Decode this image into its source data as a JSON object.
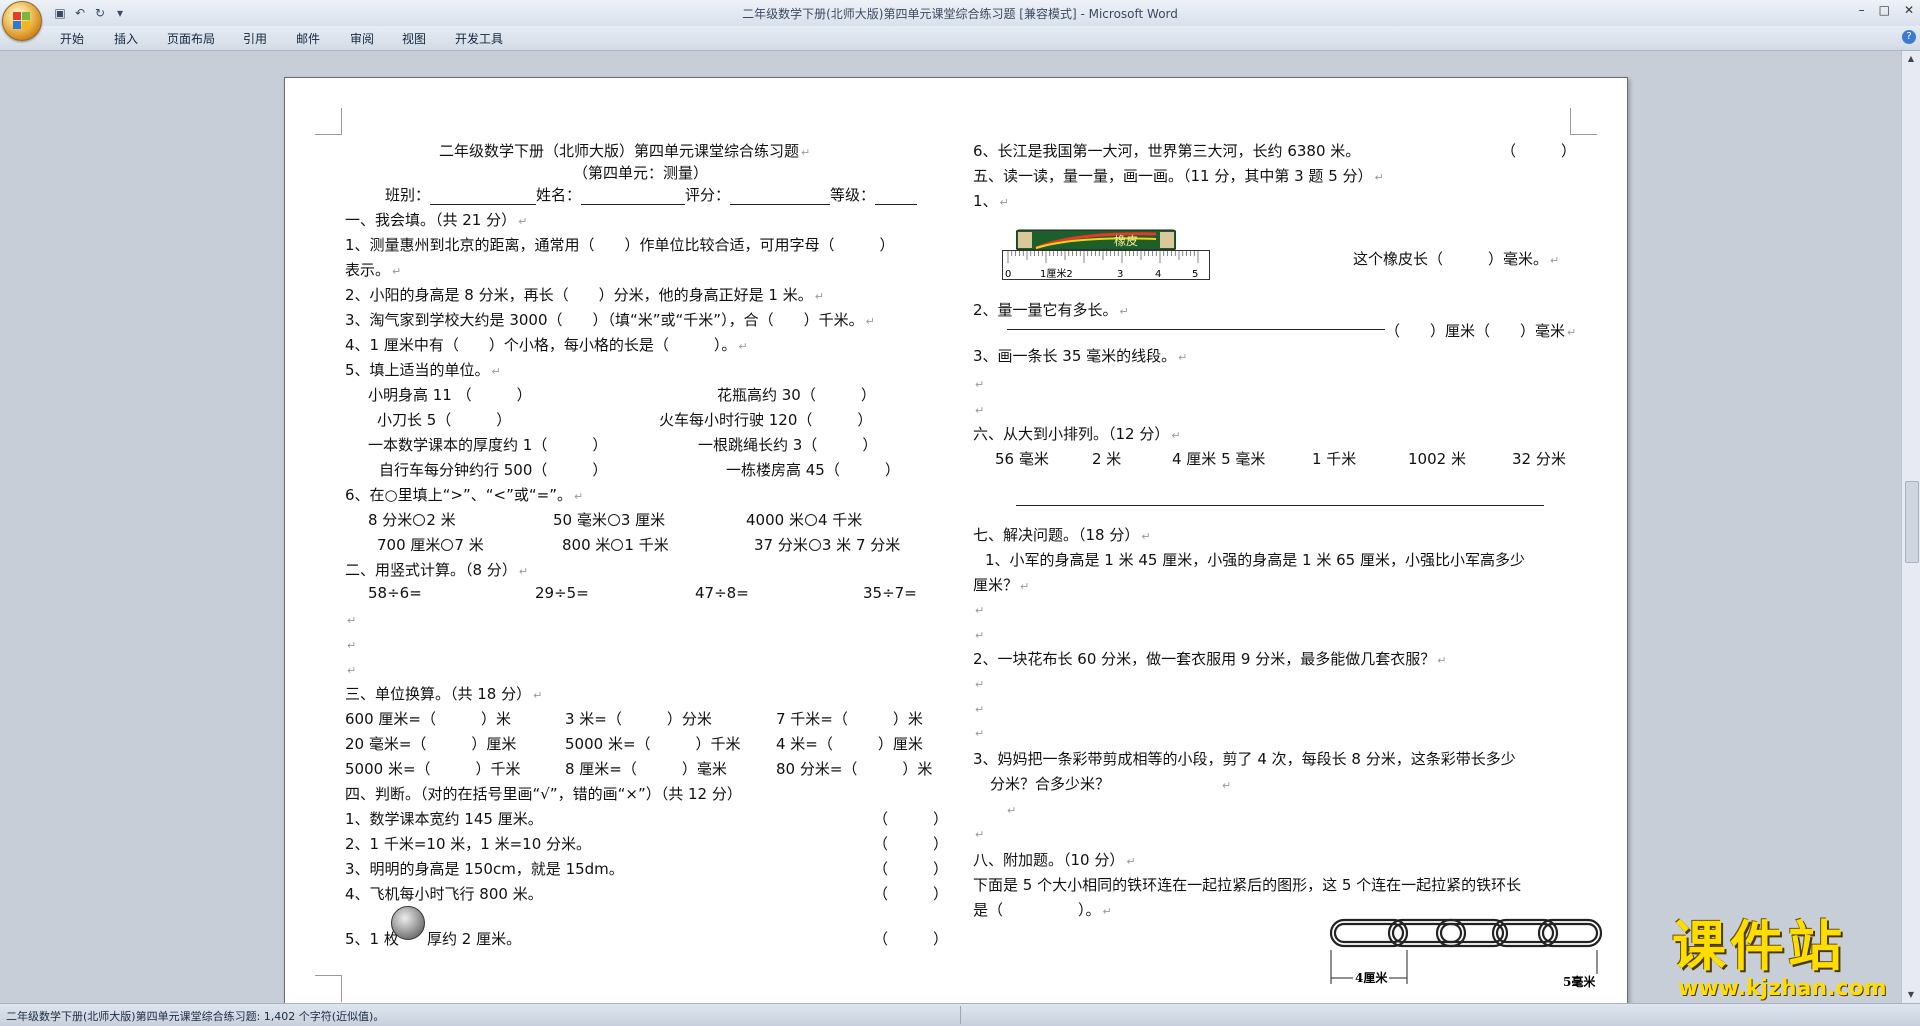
{
  "window": {
    "title": "二年级数学下册(北师大版)第四单元课堂综合练习题 [兼容模式] - Microsoft Word",
    "qat_icons": [
      "save-icon",
      "undo-icon",
      "redo-icon",
      "customize-icon"
    ]
  },
  "ribbon": {
    "tabs": [
      "开始",
      "插入",
      "页面布局",
      "引用",
      "邮件",
      "审阅",
      "视图",
      "开发工具"
    ],
    "help": "?"
  },
  "status": {
    "text": "二年级数学下册(北师大版)第四单元课堂综合练习题: 1,402 个字符(近似值)。"
  },
  "doc": {
    "title": "二年级数学下册（北师大版）第四单元课堂综合练习题",
    "subtitle": "（第四单元：测量）",
    "header": {
      "class": "班别：",
      "name": "姓名：",
      "score": "评分：",
      "grade": "等级："
    },
    "s1": {
      "heading": "一、我会填。（共 21 分）",
      "q1a": "1、测量惠州到北京的距离，通常用（　　）作单位比较合适，可用字母（　　　）",
      "q1b": "表示。",
      "q2": "2、小阳的身高是 8 分米，再长（　　）分米，他的身高正好是 1 米。",
      "q3": "3、淘气家到学校大约是 3000（　　）（填“米”或“千米”），合（　　）千米。",
      "q4": "4、1 厘米中有（　　）个小格，每小格的长是（　　　）。",
      "q5": "5、填上适当的单位。",
      "q5_items": [
        "小明身高 11 （　　　）",
        "花瓶高约 30（　　　）",
        "小刀长 5（　　　）",
        "火车每小时行驶 120（　　　）",
        "一本数学课本的厚度约 1（　　　）",
        "一根跳绳长约 3（　　　）",
        "自行车每分钟约行 500（　　　）",
        "一栋楼房高 45（　　　）"
      ],
      "q6": "6、在○里填上“>”、“<”或“=”。",
      "q6_items": [
        [
          "8 分米",
          "2 米"
        ],
        [
          "50 毫米",
          "3 厘米"
        ],
        [
          "4000 米",
          "4 千米"
        ],
        [
          "700 厘米",
          "7 米"
        ],
        [
          "800 米",
          "1 千米"
        ],
        [
          "37 分米",
          "3 米 7 分米"
        ]
      ]
    },
    "s2": {
      "heading": "二、用竖式计算。（8 分）",
      "items": [
        "58÷6=",
        "29÷5=",
        "47÷8=",
        "35÷7="
      ]
    },
    "s3": {
      "heading": "三、单位换算。（共 18 分）",
      "rows": [
        [
          "600 厘米=（　　　）米",
          "3 米=（　　　）分米",
          "7 千米=（　　　）米"
        ],
        [
          "20 毫米=（　　　）厘米",
          "5000 米=（　　　）千米",
          "4 米=（　　　）厘米"
        ],
        [
          "5000 米=（　　　）千米",
          "8 厘米=（　　　）毫米",
          "80 分米=（　　　）米"
        ]
      ]
    },
    "s4": {
      "heading": "四、判断。（对的在括号里画“√”，错的画“×”）（共 12 分）",
      "items": [
        "1、数学课本宽约 145 厘米。",
        "2、1 千米=10 米，1 米=10 分米。",
        "3、明明的身高是 150cm，就是 15dm。",
        "4、飞机每小时飞行 800 米。"
      ],
      "q5a": "5、1 枚",
      "q5b": "厚约 2 厘米。",
      "paren": "（　　　）"
    },
    "right": {
      "q6": "6、长江是我国第一大河，世界第三大河，长约 6380 米。",
      "q6_paren": "（　　　）",
      "s5_heading": "五、读一读，量一量，画一画。（11 分，其中第 3 题 5 分）",
      "s5_q1": "1、",
      "eraser_label": "橡皮",
      "ruler_ticks": [
        "0",
        "1厘米2",
        "3",
        "4",
        "5"
      ],
      "eraser_q": "这个橡皮长（　　　）毫米。",
      "s5_q2": "2、量一量它有多长。",
      "s5_q2_ans": "（　　）厘米（　　）毫米",
      "s5_q3": "3、画一条长 35 毫米的线段。",
      "s6_heading": "六、从大到小排列。（12 分）",
      "s6_items": [
        "56 毫米",
        "2 米",
        "4 厘米 5 毫米",
        "1 千米",
        "1002 米",
        "32 分米"
      ],
      "s7_heading": "七、解决问题。（18 分）",
      "s7_q1a": "1、小军的身高是 1 米 45 厘米，小强的身高是 1 米 65 厘米，小强比小军高多少",
      "s7_q1b": "厘米？",
      "s7_q2": "2、一块花布长 60 分米，做一套衣服用 9 分米，最多能做几套衣服？",
      "s7_q3a": "3、妈妈把一条彩带剪成相等的小段，剪了 4 次，每段长 8 分米，这条彩带长多少",
      "s7_q3b": "分米？合多少米？",
      "s8_heading": "八、附加题。（10 分）",
      "s8_q1": "下面是 5 个大小相同的铁环连在一起拉紧后的图形，这 5 个连在一起拉紧的铁环长",
      "s8_q2": "是（　　　　　）。",
      "chain_left": "4厘米",
      "chain_right": "5毫米"
    }
  },
  "watermark": {
    "big": "课件站",
    "url": "www.kjzhan.com"
  }
}
